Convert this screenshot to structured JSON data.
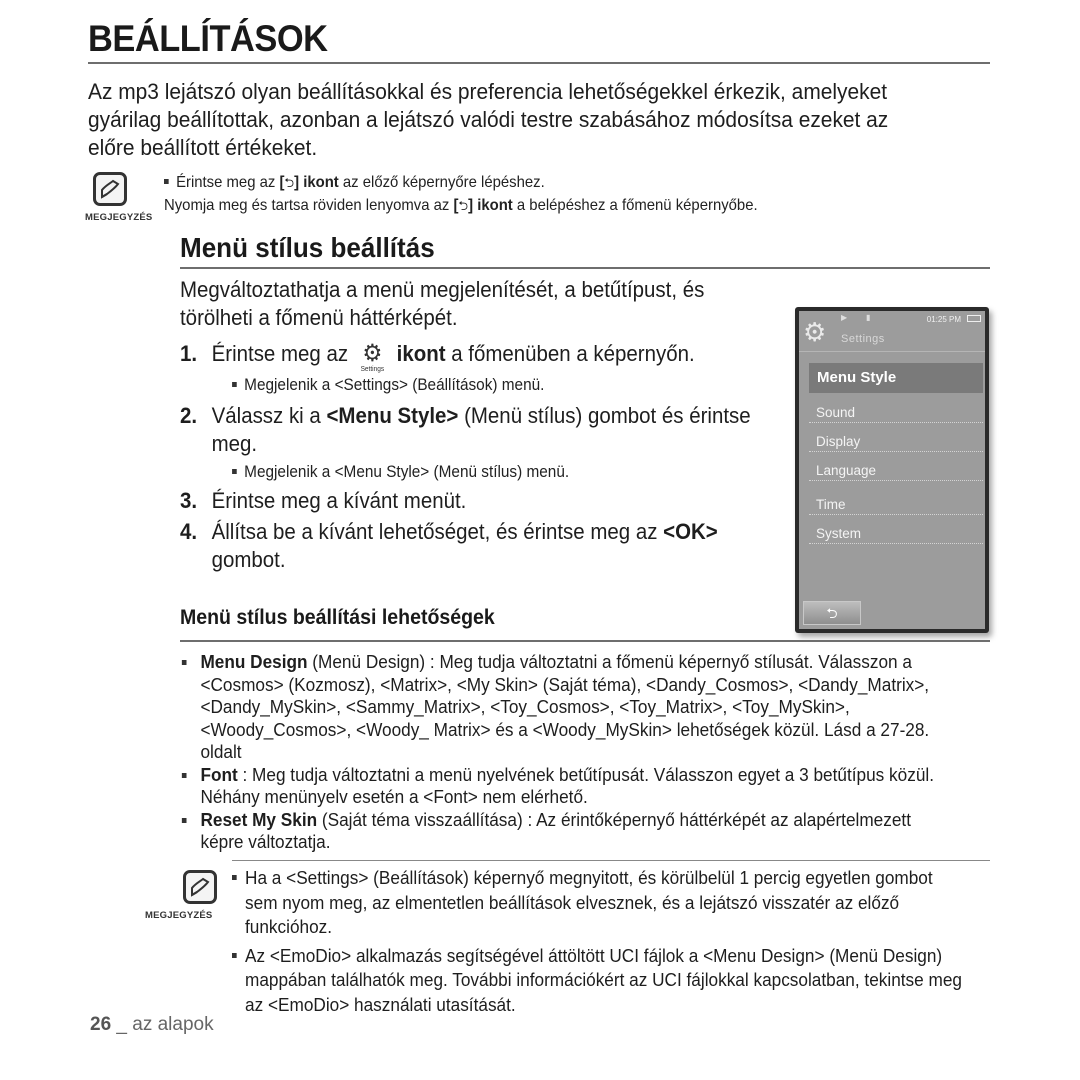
{
  "page": {
    "title": "BEÁLLÍTÁSOK",
    "intro": "Az mp3 lejátszó olyan beállításokkal és preferencia lehetőségekkel érkezik, amelyeket gyárilag beállítottak, azonban a lejátszó valódi testre szabásához módosítsa ezeket az előre beállított értékeket."
  },
  "note_top": {
    "label": "MEGJEGYZÉS",
    "icon": "pencil-note-icon",
    "line1": {
      "pre": "Érintse meg az ",
      "bracket_open": "[",
      "icon": "back-arrow-icon",
      "icon_glyph": "⮌",
      "bracket_close": "]",
      "bold": " ikont",
      "post": " az előző képernyőre lépéshez."
    },
    "line2": {
      "pre": "Nyomja meg és tartsa röviden lenyomva az ",
      "bracket_open": "[",
      "icon": "back-arrow-icon",
      "icon_glyph": "⮌",
      "bracket_close": "]",
      "bold": " ikont",
      "post": " a belépéshez a főmenü képernyőbe."
    }
  },
  "section": {
    "heading": "Menü stílus beállítás",
    "description": "Megváltoztathatja a menü megjelenítését, a betűtípust, és törölheti a főmenü háttérképét.",
    "steps": [
      {
        "num": "1.",
        "pre": "Érintse meg az ",
        "icon_caption": "Settings",
        "bold": "ikont",
        "post": " a főmenüben a képernyőn.",
        "sub": "Megjelenik a <Settings> (Beállítások) menü."
      },
      {
        "num": "2.",
        "pre": "Válassz ki a ",
        "bold": "<Menu Style>",
        "post": " (Menü stílus) gombot és érintse meg.",
        "sub": "Megjelenik a <Menu Style> (Menü stílus) menü."
      },
      {
        "num": "3.",
        "pre": "Érintse meg a kívánt menüt.",
        "bold": "",
        "post": "",
        "sub": ""
      },
      {
        "num": "4.",
        "pre": "Állítsa be a kívánt lehetőséget, és érintse meg az ",
        "bold": "<OK>",
        "post": " gombot.",
        "sub": ""
      }
    ]
  },
  "device": {
    "status_time": "01:25 PM",
    "screen_title": "Settings",
    "selected_item": "Menu Style",
    "items": [
      "Sound",
      "Display",
      "Language",
      "Time",
      "System"
    ],
    "back_glyph": "⮌"
  },
  "options": {
    "heading": "Menü stílus beállítási lehetőségek",
    "items": [
      {
        "bold": "Menu Design",
        "text": " (Menü Design) : Meg tudja változtatni a főmenü képernyő stílusát. Válasszon a <Cosmos> (Kozmosz), <Matrix>, <My Skin> (Saját téma), <Dandy_Cosmos>, <Dandy_Matrix>, <Dandy_MySkin>, <Sammy_Matrix>, <Toy_Cosmos>, <Toy_Matrix>, <Toy_MySkin>, <Woody_Cosmos>, <Woody_ Matrix> és a <Woody_MySkin> lehetőségek közül. Lásd a 27-28. oldalt"
      },
      {
        "bold": "Font",
        "text": " : Meg tudja változtatni a menü nyelvének betűtípusát. Válasszon egyet a 3 betűtípus közül. Néhány menünyelv esetén a <Font>  nem elérhető."
      },
      {
        "bold": "Reset My Skin",
        "text": " (Saját téma visszaállítása) : Az érintőképernyő háttérképét az alapértelmezett képre változtatja."
      }
    ]
  },
  "note_bottom": {
    "label": "MEGJEGYZÉS",
    "items": [
      "Ha a <Settings> (Beállítások) képernyő megnyitott, és körülbelül 1 percig egyetlen gombot sem nyom meg, az elmentetlen beállítások elvesznek, és a lejátszó visszatér az előző funkcióhoz.",
      "Az <EmoDio> alkalmazás segítségével áttöltött UCI fájlok a <Menu Design> (Menü Design) mappában találhatók meg. További információkért az UCI fájlokkal kapcsolatban, tekintse meg az <EmoDio> használati utasítását."
    ]
  },
  "footer": {
    "page_number": "26",
    "separator": " _ ",
    "section": "az alapok"
  }
}
